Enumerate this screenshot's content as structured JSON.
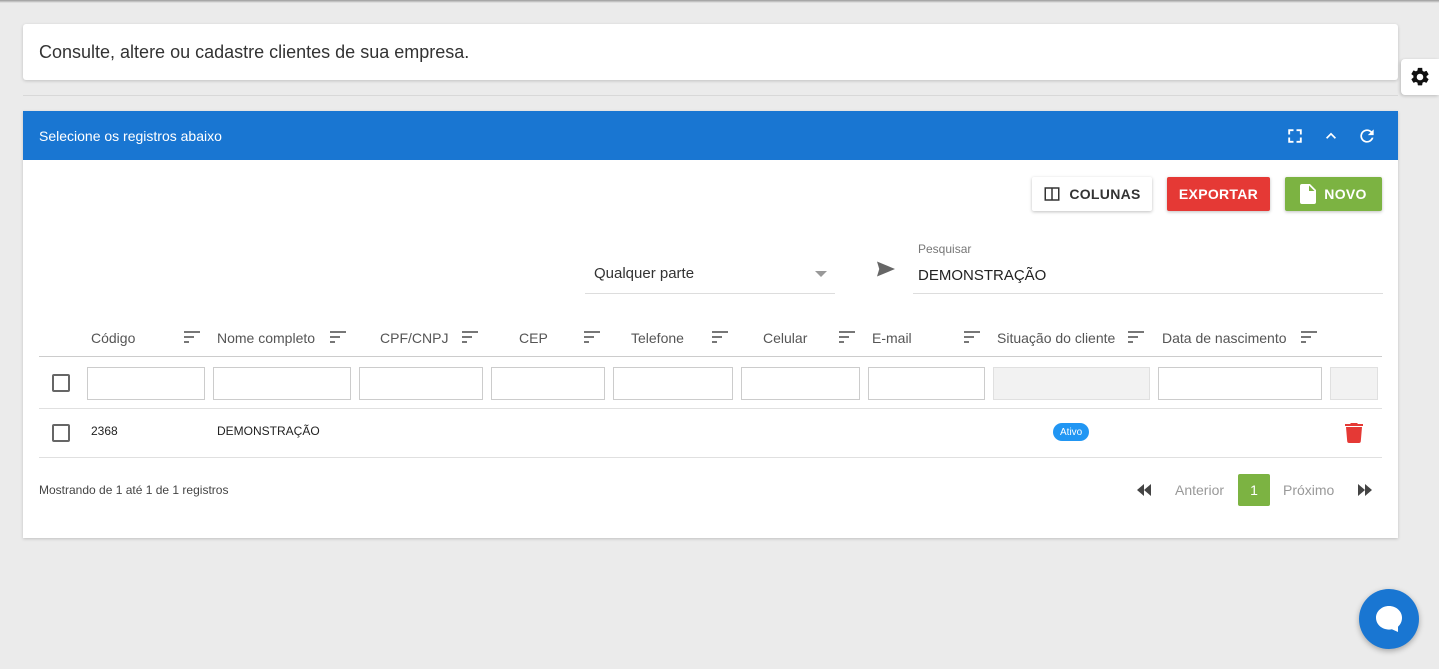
{
  "intro": {
    "text": "Consulte, altere ou cadastre clientes de sua empresa."
  },
  "panel": {
    "title": "Selecione os registros abaixo"
  },
  "toolbar": {
    "colunas_label": "COLUNAS",
    "exportar_label": "EXPORTAR",
    "novo_label": "NOVO"
  },
  "search": {
    "mode_selected": "Qualquer parte",
    "label": "Pesquisar",
    "value": "DEMONSTRAÇÃO"
  },
  "table": {
    "columns": [
      "Código",
      "Nome completo",
      "CPF/CNPJ",
      "CEP",
      "Telefone",
      "Celular",
      "E-mail",
      "Situação do cliente",
      "Data de nascimento"
    ],
    "rows": [
      {
        "codigo": "2368",
        "nome": "DEMONSTRAÇÃO",
        "situacao": "Ativo"
      }
    ]
  },
  "footer": {
    "info": "Mostrando de 1 até 1 de 1 registros",
    "prev_label": "Anterior",
    "next_label": "Próximo",
    "current_page": "1"
  },
  "colors": {
    "primary": "#1976d2",
    "danger": "#e53935",
    "success": "#7cb342",
    "badge": "#2196f3"
  }
}
